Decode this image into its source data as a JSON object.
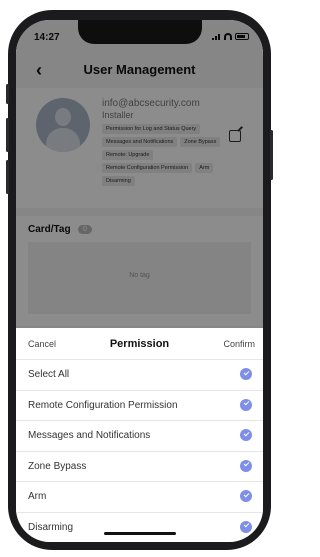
{
  "status_bar": {
    "time": "14:27"
  },
  "nav": {
    "back_glyph": "‹",
    "title": "User Management"
  },
  "user": {
    "email": "info@abcsecurity.com",
    "role": "Installer",
    "tags": [
      "Permission for Log and Status Query",
      "Messages and Notifications",
      "Zone Bypass",
      "Remote: Upgrade",
      "Remote Configuration Permission",
      "Arm",
      "Disarming"
    ]
  },
  "card_section": {
    "title": "Card/Tag",
    "count": "0",
    "empty_text": "No tag"
  },
  "sheet": {
    "cancel_label": "Cancel",
    "title": "Permission",
    "confirm_label": "Confirm",
    "options": [
      {
        "label": "Select All",
        "checked": true
      },
      {
        "label": "Remote Configuration Permission",
        "checked": true
      },
      {
        "label": "Messages and Notifications",
        "checked": true
      },
      {
        "label": "Zone Bypass",
        "checked": true
      },
      {
        "label": "Arm",
        "checked": true
      },
      {
        "label": "Disarming",
        "checked": true
      }
    ]
  },
  "colors": {
    "accent": "#7f8fe8",
    "overlay": "rgba(0,0,0,0.45)"
  }
}
